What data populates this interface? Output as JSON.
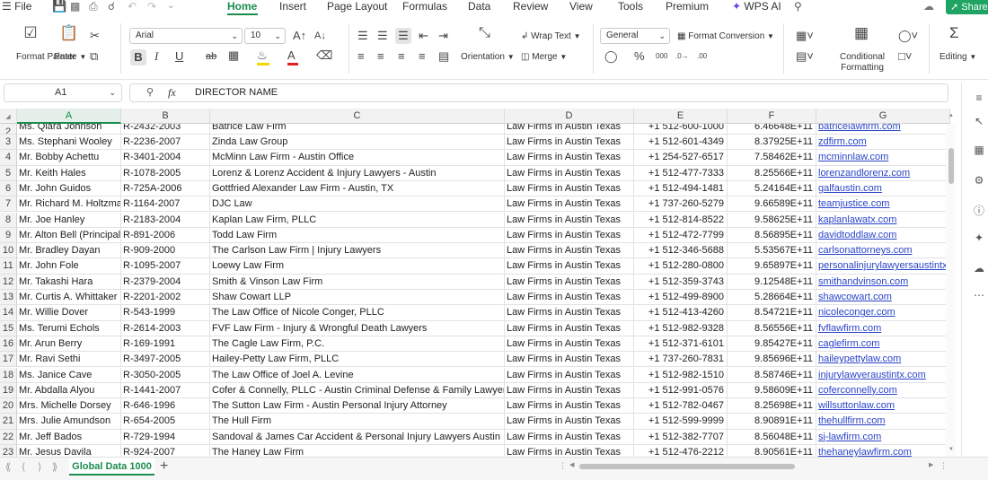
{
  "menu": {
    "file": "File",
    "tabs": [
      "Home",
      "Insert",
      "Page Layout",
      "Formulas",
      "Data",
      "Review",
      "View",
      "Tools",
      "Premium",
      "WPS AI"
    ],
    "share": "Share"
  },
  "ribbon": {
    "format_painter": "Format Painter",
    "paste": "Paste",
    "font_name": "Arial",
    "font_size": "10",
    "wrap_text": "Wrap Text",
    "orientation": "Orientation",
    "merge": "Merge",
    "number_format": "General",
    "format_conversion": "Format Conversion",
    "conditional_formatting": "Conditional Formatting",
    "editing": "Editing",
    "font_color_hex": "#e02020",
    "fill_color_hex": "#f5d800"
  },
  "formula_bar": {
    "cell_ref": "A1",
    "fx": "fx",
    "content": "DIRECTOR NAME"
  },
  "grid": {
    "columns": [
      "A",
      "B",
      "C",
      "D",
      "E",
      "F",
      "G"
    ],
    "selected_column": "A",
    "rows": [
      {
        "n": "2",
        "a": "Ms. Qiara Johnson",
        "b": "R-2432-2003",
        "c": "Batrice Law Firm",
        "d": "Law Firms in Austin Texas",
        "e": "+1 512-600-1000",
        "f": "6.46648E+11",
        "g": "batricelawfirm.com"
      },
      {
        "n": "3",
        "a": "Ms. Stephani Wooley",
        "b": "R-2236-2007",
        "c": "Zinda Law Group",
        "d": "Law Firms in Austin Texas",
        "e": "+1 512-601-4349",
        "f": "8.37925E+11",
        "g": "zdfirm.com"
      },
      {
        "n": "4",
        "a": "Mr. Bobby Achettu",
        "b": "R-3401-2004",
        "c": "McMinn Law Firm - Austin Office",
        "d": "Law Firms in Austin Texas",
        "e": "+1 254-527-6517",
        "f": "7.58462E+11",
        "g": "mcminnlaw.com"
      },
      {
        "n": "5",
        "a": "Mr. Keith Hales",
        "b": "R-1078-2005",
        "c": "Lorenz & Lorenz Accident & Injury Lawyers - Austin",
        "d": "Law Firms in Austin Texas",
        "e": "+1 512-477-7333",
        "f": "8.25566E+11",
        "g": "lorenzandlorenz.com"
      },
      {
        "n": "6",
        "a": "Mr. John Guidos",
        "b": "R-725A-2006",
        "c": "Gottfried Alexander Law Firm - Austin, TX",
        "d": "Law Firms in Austin Texas",
        "e": "+1 512-494-1481",
        "f": "5.24164E+11",
        "g": "galfaustin.com"
      },
      {
        "n": "7",
        "a": "Mr. Richard M. Holtzman",
        "b": "R-1164-2007",
        "c": "DJC Law",
        "d": "Law Firms in Austin Texas",
        "e": "+1 737-260-5279",
        "f": "9.66589E+11",
        "g": "teamjustice.com"
      },
      {
        "n": "8",
        "a": "Mr. Joe Hanley",
        "b": "R-2183-2004",
        "c": "Kaplan Law Firm, PLLC",
        "d": "Law Firms in Austin Texas",
        "e": "+1 512-814-8522",
        "f": "9.58625E+11",
        "g": "kaplanlawatx.com"
      },
      {
        "n": "9",
        "a": "Mr. Alton Bell (Principal)",
        "b": "R-891-2006",
        "c": "Todd Law Firm",
        "d": "Law Firms in Austin Texas",
        "e": "+1 512-472-7799",
        "f": "8.56895E+11",
        "g": "davidtoddlaw.com"
      },
      {
        "n": "10",
        "a": "Mr. Bradley Dayan",
        "b": "R-909-2000",
        "c": "The Carlson Law Firm | Injury Lawyers",
        "d": "Law Firms in Austin Texas",
        "e": "+1 512-346-5688",
        "f": "5.53567E+11",
        "g": "carlsonattorneys.com"
      },
      {
        "n": "11",
        "a": "Mr. John Fole",
        "b": "R-1095-2007",
        "c": "Loewy Law Firm",
        "d": "Law Firms in Austin Texas",
        "e": "+1 512-280-0800",
        "f": "9.65897E+11",
        "g": "personalinjurylawyersaustintx"
      },
      {
        "n": "12",
        "a": "Mr. Takashi Hara",
        "b": "R-2379-2004",
        "c": "Smith & Vinson Law Firm",
        "d": "Law Firms in Austin Texas",
        "e": "+1 512-359-3743",
        "f": "9.12548E+11",
        "g": "smithandvinson.com"
      },
      {
        "n": "13",
        "a": "Mr. Curtis A. Whittaker",
        "b": "R-2201-2002",
        "c": "Shaw Cowart LLP",
        "d": "Law Firms in Austin Texas",
        "e": "+1 512-499-8900",
        "f": "5.28664E+11",
        "g": "shawcowart.com"
      },
      {
        "n": "14",
        "a": "Mr. Willie Dover",
        "b": "R-543-1999",
        "c": "The Law Office of Nicole Conger, PLLC",
        "d": "Law Firms in Austin Texas",
        "e": "+1 512-413-4260",
        "f": "8.54721E+11",
        "g": "nicoleconger.com"
      },
      {
        "n": "15",
        "a": "Ms. Terumi Echols",
        "b": "R-2614-2003",
        "c": "FVF Law Firm - Injury & Wrongful Death Lawyers",
        "d": "Law Firms in Austin Texas",
        "e": "+1 512-982-9328",
        "f": "8.56556E+11",
        "g": "fvflawfirm.com"
      },
      {
        "n": "16",
        "a": "Mr. Arun Berry",
        "b": "R-169-1991",
        "c": "The Cagle Law Firm, P.C.",
        "d": "Law Firms in Austin Texas",
        "e": "+1 512-371-6101",
        "f": "9.85427E+11",
        "g": "caglefirm.com"
      },
      {
        "n": "17",
        "a": "Mr. Ravi Sethi",
        "b": "R-3497-2005",
        "c": "Hailey-Petty Law Firm, PLLC",
        "d": "Law Firms in Austin Texas",
        "e": "+1 737-260-7831",
        "f": "9.85696E+11",
        "g": "haileypettylaw.com"
      },
      {
        "n": "18",
        "a": "Ms. Janice Cave",
        "b": "R-3050-2005",
        "c": "The Law Office of Joel A. Levine",
        "d": "Law Firms in Austin Texas",
        "e": "+1 512-982-1510",
        "f": "8.58746E+11",
        "g": "injurylawyeraustintx.com"
      },
      {
        "n": "19",
        "a": "Mr. Abdalla Alyou",
        "b": "R-1441-2007",
        "c": "Cofer & Connelly, PLLC - Austin Criminal Defense & Family Lawyer",
        "d": "Law Firms in Austin Texas",
        "e": "+1 512-991-0576",
        "f": "9.58609E+11",
        "g": "coferconnelly.com"
      },
      {
        "n": "20",
        "a": "Mrs. Michelle Dorsey",
        "b": "R-646-1996",
        "c": "The Sutton Law Firm - Austin Personal Injury Attorney",
        "d": "Law Firms in Austin Texas",
        "e": "+1 512-782-0467",
        "f": "8.25698E+11",
        "g": "willsuttonlaw.com"
      },
      {
        "n": "21",
        "a": "Mrs. Julie Amundson",
        "b": "R-654-2005",
        "c": "The Hull Firm",
        "d": "Law Firms in Austin Texas",
        "e": "+1 512-599-9999",
        "f": "8.90891E+11",
        "g": "thehullfirm.com"
      },
      {
        "n": "22",
        "a": "Mr. Jeff Bados",
        "b": "R-729-1994",
        "c": "Sandoval & James Car Accident & Personal Injury Lawyers Austin",
        "d": "Law Firms in Austin Texas",
        "e": "+1 512-382-7707",
        "f": "8.56048E+11",
        "g": "sj-lawfirm.com"
      },
      {
        "n": "23",
        "a": "Mr. Jesus Davila",
        "b": "R-924-2007",
        "c": "The Haney Law Firm",
        "d": "Law Firms in Austin Texas",
        "e": "+1 512-476-2212",
        "f": "8.90561E+11",
        "g": "thehaneylawfirm.com"
      }
    ]
  },
  "sheet": {
    "tab_name": "Global Data 1000",
    "add_sheet": "+"
  }
}
